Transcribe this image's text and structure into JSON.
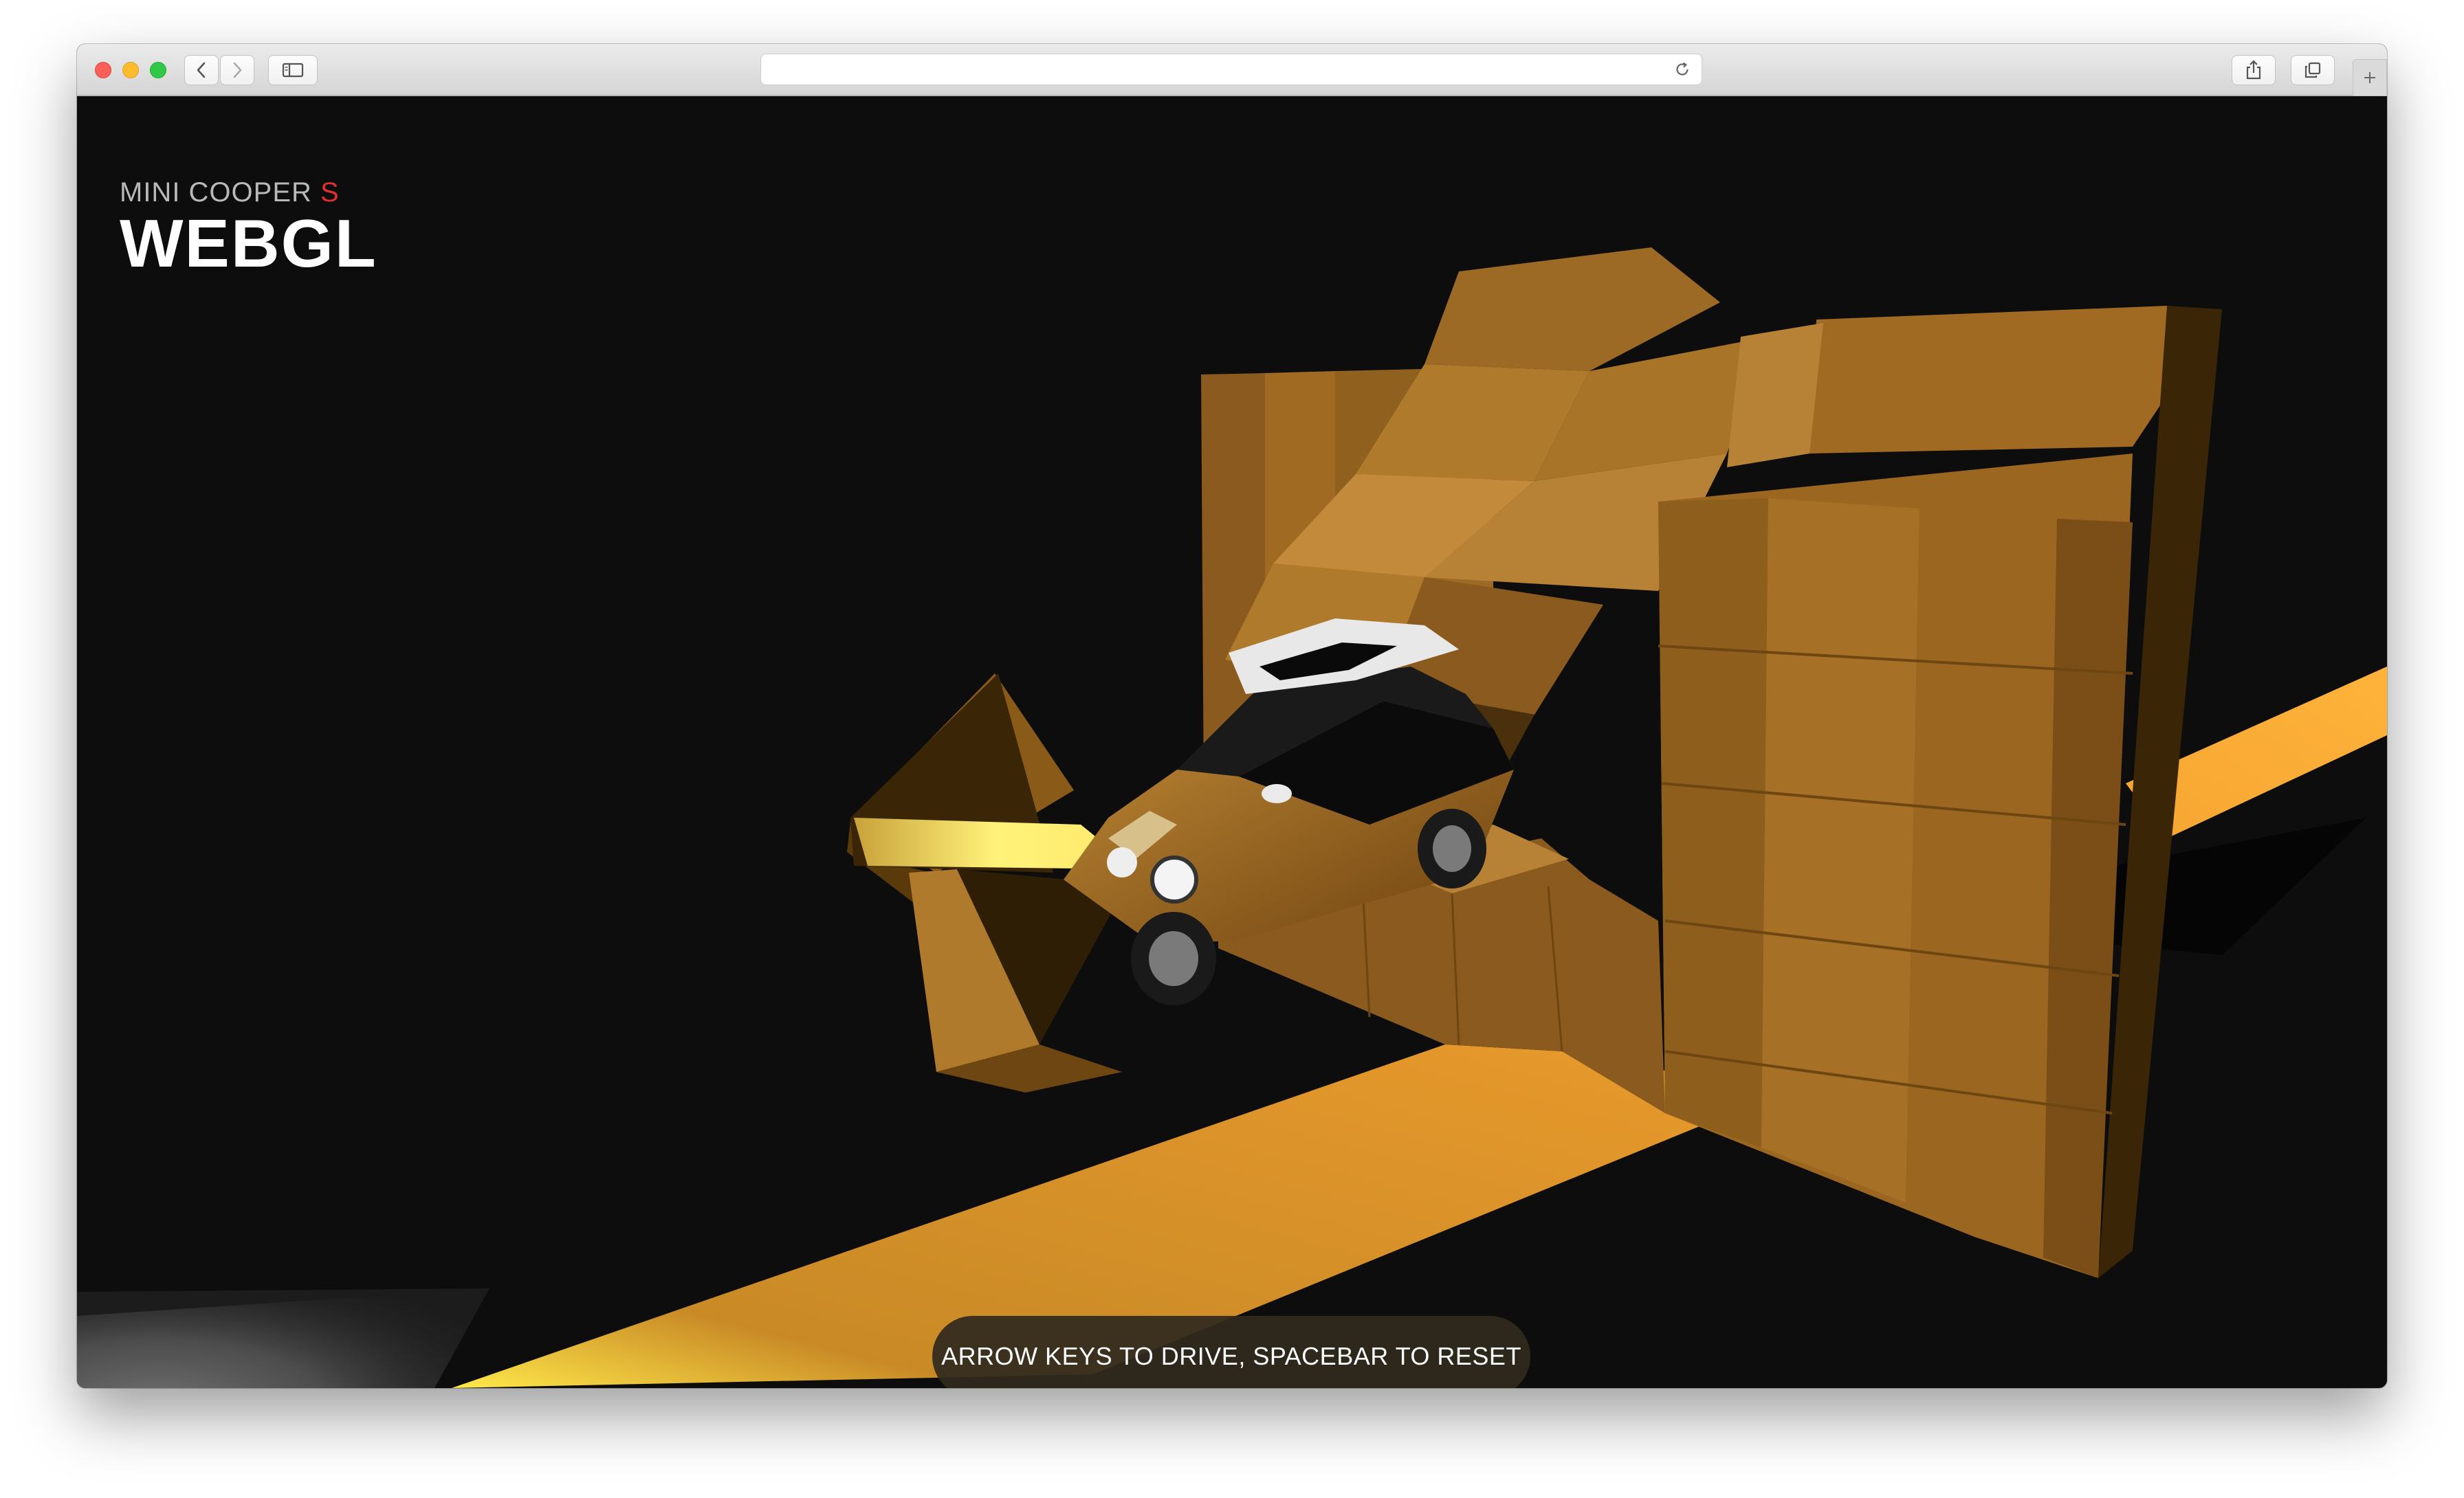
{
  "browser": {
    "address_text": "",
    "icons": {
      "back": "chevron-left-icon",
      "forward": "chevron-right-icon",
      "sidebar": "sidebar-icon",
      "reload": "reload-icon",
      "share": "share-icon",
      "tabs": "tabs-icon",
      "new_tab": "plus-icon"
    }
  },
  "page": {
    "logo": {
      "model_prefix": "MINI COOPER",
      "model_suffix": "S",
      "title": "WEBGL"
    },
    "instructions": "ARROW KEYS TO DRIVE, SPACEBAR TO RESET",
    "colors": {
      "background": "#0d0d0d",
      "box": "#b07a2c",
      "road": "#f0a030",
      "car_body": "#9a6418",
      "accent_red": "#e0312a"
    }
  }
}
